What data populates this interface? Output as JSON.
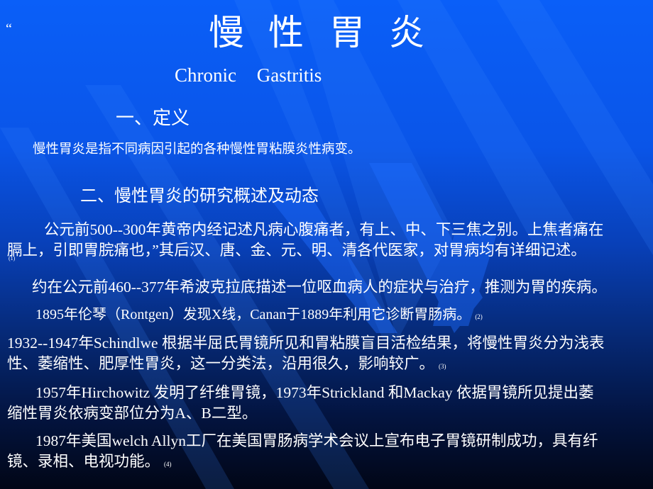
{
  "slide": {
    "quote_mark": "“",
    "title_chars": [
      "慢",
      "性",
      "胃",
      "炎"
    ],
    "subtitle": "Chronic Gastritis",
    "section1_heading": "一、定义",
    "definition": "慢性胃炎是指不同病因引起的各种慢性胃粘膜炎性病变。",
    "section2_heading": "二、慢性胃炎的研究概述及动态",
    "paragraphs": [
      {
        "lines": [
          "公元前500--300年黄帝内经记述凡病心腹痛者，有上、中、下三焦之别。上焦者痛在",
          "膈上，引即胃脘痛也，”其后汉、唐、金、元、明、清各代医家，对胃病均有详细记述。"
        ],
        "ref": "(1)"
      },
      {
        "lines": [
          "约在公元前460--377年希波克拉底描述一位呕血病人的症状与治疗，推测为胃的疾病。"
        ],
        "ref": ""
      },
      {
        "lines": [
          "1895年伦琴（Rontgen）发现X线，Canan于1889年利用它诊断胃肠病。"
        ],
        "ref": "(2)"
      },
      {
        "lines": [
          "1932--1947年Schindlwe 根据半屈氏胃镜所见和胃粘膜盲目活检结果，将慢性胃炎分为浅表",
          "性、萎缩性、肥厚性胃炎，这一分类法，沿用很久，影响较广。"
        ],
        "ref": "(3)"
      },
      {
        "lines": [
          "1957年Hirchowitz 发明了纤维胃镜，1973年Strickland 和Mackay 依据胃镜所见提出萎",
          "缩性胃炎依病变部位分为A、B二型。"
        ],
        "ref": ""
      },
      {
        "lines": [
          "1987年美国welch  Allyn工厂在美国胃肠病学术会议上宣布电子胃镜研制成功，具有纤",
          "镜、录相、电视功能。"
        ],
        "ref": "(4)"
      }
    ]
  },
  "colors": {
    "background_top": "#0a5ff8",
    "background_bottom": "#010616",
    "text": "#ffffff"
  }
}
